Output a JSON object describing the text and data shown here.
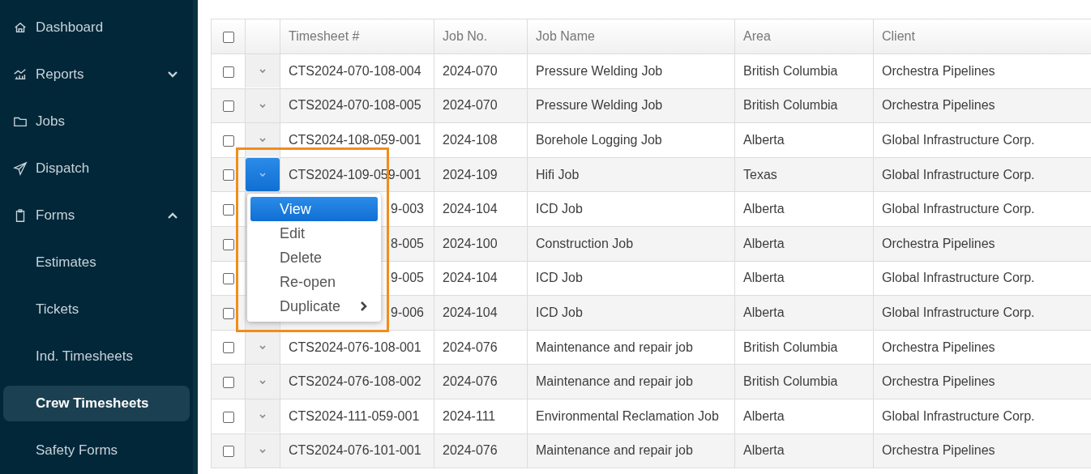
{
  "sidebar": {
    "items": [
      {
        "label": "Dashboard",
        "selected": false
      },
      {
        "label": "Reports",
        "selected": false,
        "expanded": false
      },
      {
        "label": "Jobs",
        "selected": false
      },
      {
        "label": "Dispatch",
        "selected": false
      },
      {
        "label": "Forms",
        "selected": false,
        "expanded": true,
        "children": [
          {
            "label": "Estimates",
            "selected": false
          },
          {
            "label": "Tickets",
            "selected": false
          },
          {
            "label": "Ind. Timesheets",
            "selected": false
          },
          {
            "label": "Crew Timesheets",
            "selected": true
          },
          {
            "label": "Safety Forms",
            "selected": false
          }
        ]
      }
    ]
  },
  "table": {
    "select_all": {
      "checked": false
    },
    "columns": [
      "Timesheet #",
      "Job No.",
      "Job Name",
      "Area",
      "Client"
    ],
    "rows": [
      {
        "checked": false,
        "menu_open": false,
        "cells": [
          "CTS2024-070-108-004",
          "2024-070",
          "Pressure Welding Job",
          "British Columbia",
          "Orchestra Pipelines"
        ]
      },
      {
        "checked": false,
        "menu_open": false,
        "cells": [
          "CTS2024-070-108-005",
          "2024-070",
          "Pressure Welding Job",
          "British Columbia",
          "Orchestra Pipelines"
        ]
      },
      {
        "checked": false,
        "menu_open": false,
        "cells": [
          "CTS2024-108-059-001",
          "2024-108",
          "Borehole Logging Job",
          "Alberta",
          "Global Infrastructure Corp."
        ]
      },
      {
        "checked": false,
        "menu_open": true,
        "cells": [
          "CTS2024-109-059-001",
          "2024-109",
          "Hifi Job",
          "Texas",
          "Global Infrastructure Corp."
        ]
      },
      {
        "checked": false,
        "menu_open": false,
        "cells": [
          "9-003",
          "2024-104",
          "ICD Job",
          "Alberta",
          "Global Infrastructure Corp."
        ]
      },
      {
        "checked": false,
        "menu_open": false,
        "cells": [
          "8-005",
          "2024-100",
          "Construction Job",
          "Alberta",
          "Orchestra Pipelines"
        ]
      },
      {
        "checked": false,
        "menu_open": false,
        "cells": [
          "9-005",
          "2024-104",
          "ICD Job",
          "Alberta",
          "Global Infrastructure Corp."
        ]
      },
      {
        "checked": false,
        "menu_open": false,
        "cells": [
          "9-006",
          "2024-104",
          "ICD Job",
          "Alberta",
          "Global Infrastructure Corp."
        ]
      },
      {
        "checked": false,
        "menu_open": false,
        "cells": [
          "CTS2024-076-108-001",
          "2024-076",
          "Maintenance and repair job",
          "British Columbia",
          "Orchestra Pipelines"
        ]
      },
      {
        "checked": false,
        "menu_open": false,
        "cells": [
          "CTS2024-076-108-002",
          "2024-076",
          "Maintenance and repair job",
          "British Columbia",
          "Orchestra Pipelines"
        ]
      },
      {
        "checked": false,
        "menu_open": false,
        "cells": [
          "CTS2024-111-059-001",
          "2024-111",
          "Environmental Reclamation Job",
          "Alberta",
          "Global Infrastructure Corp."
        ]
      },
      {
        "checked": false,
        "menu_open": false,
        "cells": [
          "CTS2024-076-101-001",
          "2024-076",
          "Maintenance and repair job",
          "Alberta",
          "Orchestra Pipelines"
        ]
      }
    ]
  },
  "row_menu": {
    "items": [
      {
        "label": "View",
        "selected": true,
        "submenu": false
      },
      {
        "label": "Edit",
        "selected": false,
        "submenu": false
      },
      {
        "label": "Delete",
        "selected": false,
        "submenu": false
      },
      {
        "label": "Re-open",
        "selected": false,
        "submenu": false
      },
      {
        "label": "Duplicate",
        "selected": false,
        "submenu": true
      }
    ]
  }
}
